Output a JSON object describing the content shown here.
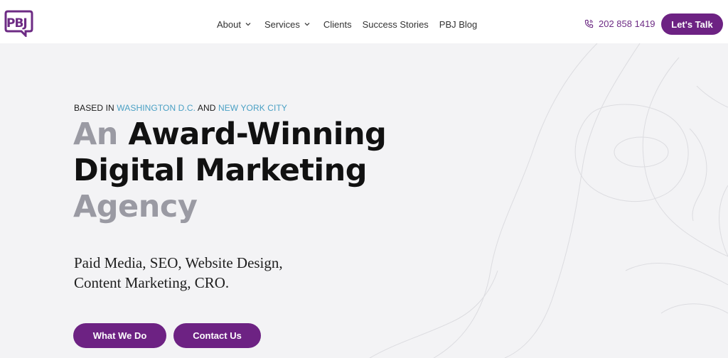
{
  "brand": {
    "logo_text": "PBJ",
    "accent": "#6d2283",
    "link_blue": "#4aa0c4"
  },
  "nav": {
    "items": [
      {
        "label": "About",
        "has_dropdown": true
      },
      {
        "label": "Services",
        "has_dropdown": true
      },
      {
        "label": "Clients",
        "has_dropdown": false
      },
      {
        "label": "Success Stories",
        "has_dropdown": false
      },
      {
        "label": "PBJ Blog",
        "has_dropdown": false
      }
    ]
  },
  "contact": {
    "phone": "202 858 1419",
    "phone_icon": "phone-icon",
    "cta_label": "Let's Talk"
  },
  "hero": {
    "eyebrow_prefix": "BASED IN ",
    "eyebrow_city1": "WASHINGTON D.C.",
    "eyebrow_mid": " AND ",
    "eyebrow_city2": "NEW YORK CITY",
    "headline_an": "An",
    "headline_award": "Award-Winning",
    "headline_line2": "Digital Marketing",
    "headline_agency": "Agency",
    "subtitle_line1": "Paid Media, SEO, Website Design,",
    "subtitle_line2": "Content Marketing, CRO.",
    "primary_button": "What We Do",
    "secondary_button": "Contact Us"
  }
}
